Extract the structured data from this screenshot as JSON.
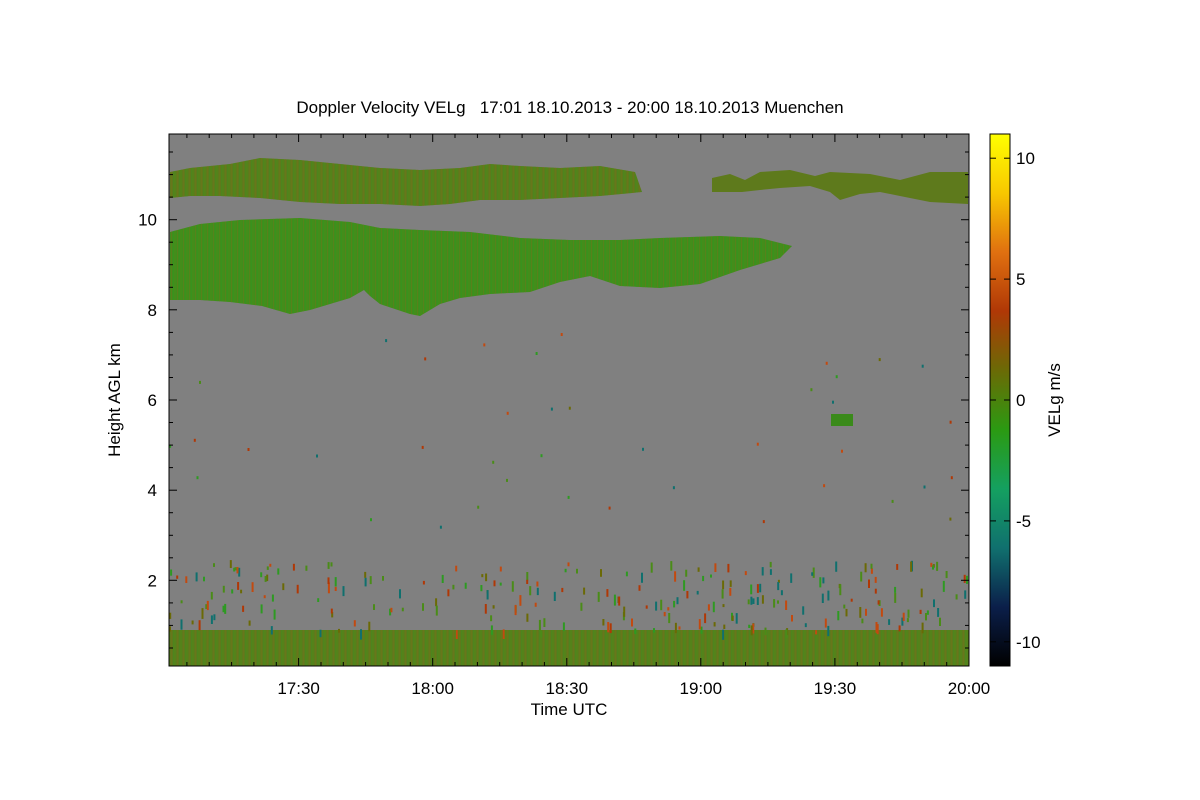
{
  "chart_data": {
    "type": "heatmap",
    "title": "Doppler Velocity VELg   17:01 18.10.2013 - 20:00 18.10.2013 Muenchen",
    "xlabel": "Time UTC",
    "ylabel": "Height AGL km",
    "xlim_minutes_utc": [
      1021,
      1200
    ],
    "ylim_km": [
      0.1,
      11.9
    ],
    "x_tick_values_minutes_utc": [
      1050,
      1080,
      1110,
      1140,
      1170,
      1200
    ],
    "x_tick_labels": [
      "17:30",
      "18:00",
      "18:30",
      "19:00",
      "19:30",
      "20:00"
    ],
    "y_tick_values": [
      2,
      4,
      6,
      8,
      10
    ],
    "y_tick_labels": [
      "2",
      "4",
      "6",
      "8",
      "10"
    ],
    "background_color": "#808080",
    "colorbar": {
      "label": "VELg m/s",
      "range": [
        -11,
        11
      ],
      "tick_values": [
        -10,
        -5,
        0,
        5,
        10
      ],
      "tick_labels": [
        "-10",
        "-5",
        "0",
        "5",
        "10"
      ],
      "colors": [
        "#000000",
        "#0b1f4a",
        "#10706e",
        "#14a060",
        "#2b9a12",
        "#6b6a06",
        "#b03806",
        "#e07010",
        "#f8c800",
        "#ffff00"
      ]
    },
    "regions": [
      {
        "feature": "upper cirrus layer",
        "time_utc": [
          "17:01",
          "20:00"
        ],
        "height_km": [
          10.4,
          11.4
        ],
        "velocity_ms": -1,
        "color": "#5e7a1c"
      },
      {
        "feature": "main cloud layer",
        "time_utc": [
          "17:01",
          "19:15"
        ],
        "height_km": [
          8.0,
          10.2
        ],
        "velocity_ms": -1.5,
        "color": "#3f8e1c"
      },
      {
        "feature": "small echo",
        "time_utc": [
          "19:30",
          "19:33"
        ],
        "height_km": [
          5.55,
          5.8
        ],
        "velocity_ms": -2,
        "color": "#3a8a1a"
      },
      {
        "feature": "boundary layer",
        "time_utc": [
          "17:01",
          "20:00"
        ],
        "height_km": [
          0.1,
          0.9
        ],
        "velocity_ms": 0,
        "color": "#5e7a1c"
      }
    ]
  }
}
